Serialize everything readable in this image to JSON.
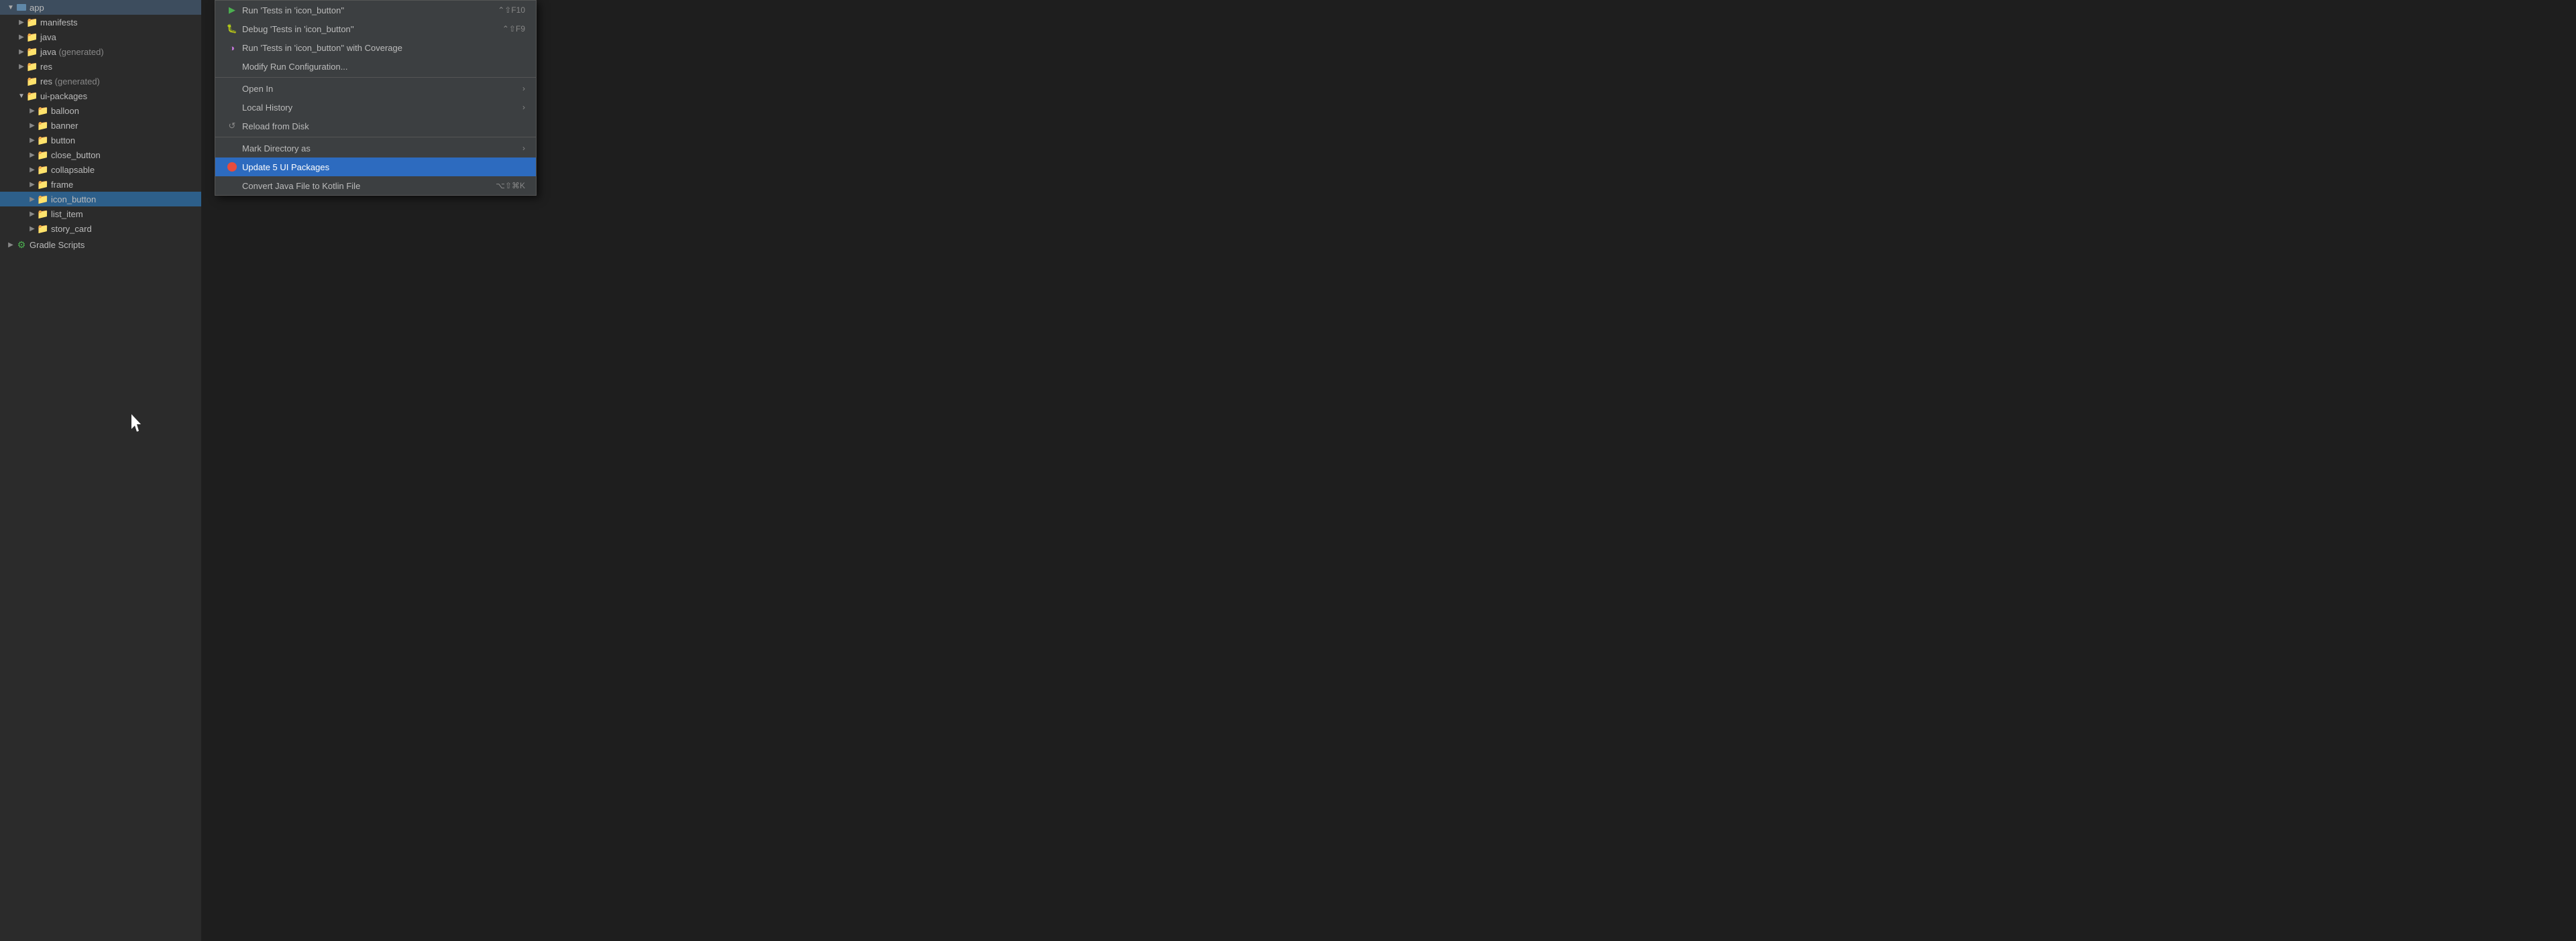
{
  "sidebar": {
    "app_label": "app",
    "items": [
      {
        "id": "manifests",
        "label": "manifests",
        "indent": "indent-2",
        "arrow": "▶",
        "folder": "blue",
        "expanded": false
      },
      {
        "id": "java",
        "label": "java",
        "indent": "indent-2",
        "arrow": "▶",
        "folder": "blue",
        "expanded": false
      },
      {
        "id": "java-generated",
        "label": "java",
        "suffix": " (generated)",
        "indent": "indent-2",
        "arrow": "▶",
        "folder": "special",
        "expanded": false
      },
      {
        "id": "res",
        "label": "res",
        "indent": "indent-2",
        "arrow": "▶",
        "folder": "blue",
        "expanded": false
      },
      {
        "id": "res-generated",
        "label": "res",
        "suffix": " (generated)",
        "indent": "indent-2",
        "arrow": null,
        "folder": "special",
        "expanded": false
      },
      {
        "id": "ui-packages",
        "label": "ui-packages",
        "indent": "indent-2",
        "arrow": "▼",
        "folder": "blue",
        "expanded": true
      },
      {
        "id": "balloon",
        "label": "balloon",
        "indent": "indent-3",
        "arrow": "▶",
        "folder": "blue",
        "selected": false
      },
      {
        "id": "banner",
        "label": "banner",
        "indent": "indent-3",
        "arrow": "▶",
        "folder": "blue",
        "selected": false
      },
      {
        "id": "button",
        "label": "button",
        "indent": "indent-3",
        "arrow": "▶",
        "folder": "blue",
        "selected": false
      },
      {
        "id": "close_button",
        "label": "close_button",
        "indent": "indent-3",
        "arrow": "▶",
        "folder": "blue",
        "selected": false
      },
      {
        "id": "collapsable",
        "label": "collapsable",
        "indent": "indent-3",
        "arrow": "▶",
        "folder": "blue",
        "selected": false
      },
      {
        "id": "frame",
        "label": "frame",
        "indent": "indent-3",
        "arrow": "▶",
        "folder": "blue",
        "selected": false
      },
      {
        "id": "icon_button",
        "label": "icon_button",
        "indent": "indent-3",
        "arrow": "▶",
        "folder": "blue",
        "selected": true
      },
      {
        "id": "list_item",
        "label": "list_item",
        "indent": "indent-3",
        "arrow": "▶",
        "folder": "blue",
        "selected": false
      },
      {
        "id": "story_card",
        "label": "story_card",
        "indent": "indent-3",
        "arrow": "▶",
        "folder": "blue",
        "selected": false
      }
    ],
    "gradle_label": "Gradle Scripts"
  },
  "context_menu": {
    "items": [
      {
        "id": "run-tests",
        "label": "Run 'Tests in 'icon_button''",
        "shortcut": "⌃⇧F10",
        "icon": "run",
        "separator_after": false
      },
      {
        "id": "debug-tests",
        "label": "Debug 'Tests in 'icon_button''",
        "shortcut": "⌃⇧F9",
        "icon": "debug",
        "separator_after": false
      },
      {
        "id": "run-coverage",
        "label": "Run 'Tests in 'icon_button'' with Coverage",
        "shortcut": "",
        "icon": "coverage",
        "separator_after": false
      },
      {
        "id": "modify-run",
        "label": "Modify Run Configuration...",
        "shortcut": "",
        "icon": null,
        "separator_after": true
      },
      {
        "id": "open-in",
        "label": "Open In",
        "shortcut": "",
        "submenu": true,
        "separator_after": false
      },
      {
        "id": "local-history",
        "label": "Local History",
        "shortcut": "",
        "submenu": true,
        "separator_after": false
      },
      {
        "id": "reload-disk",
        "label": "Reload from Disk",
        "shortcut": "",
        "icon": "reload",
        "separator_after": true
      },
      {
        "id": "mark-directory",
        "label": "Mark Directory as",
        "shortcut": "",
        "submenu": true,
        "separator_after": false
      },
      {
        "id": "update-packages",
        "label": "Update 5 UI Packages",
        "shortcut": "",
        "icon": "update",
        "highlighted": true,
        "separator_after": false
      },
      {
        "id": "convert-java",
        "label": "Convert Java File to Kotlin File",
        "shortcut": "⌥⇧⌘K",
        "separator_after": false
      }
    ]
  }
}
